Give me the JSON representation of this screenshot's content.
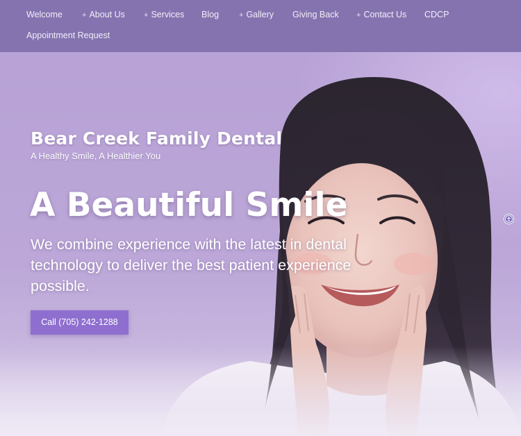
{
  "nav": {
    "items": [
      {
        "label": "Welcome",
        "has_submenu": false
      },
      {
        "label": "About Us",
        "has_submenu": true
      },
      {
        "label": "Services",
        "has_submenu": true
      },
      {
        "label": "Blog",
        "has_submenu": false
      },
      {
        "label": "Gallery",
        "has_submenu": true
      },
      {
        "label": "Giving Back",
        "has_submenu": false
      },
      {
        "label": "Contact Us",
        "has_submenu": true
      },
      {
        "label": "CDCP",
        "has_submenu": false
      },
      {
        "label": "Appointment Request",
        "has_submenu": false
      }
    ],
    "submenu_marker": "+"
  },
  "hero": {
    "brand_title": "Bear Creek Family Dental",
    "tagline": "A Healthy Smile, A Healthier You",
    "headline": "A Beautiful Smile",
    "body": "We combine experience with the latest in dental technology to deliver the best patient experience possible.",
    "cta_label": "Call (705) 242-1288"
  },
  "icons": {
    "accessibility": "accessibility-icon"
  },
  "colors": {
    "nav_background": "#8573b0",
    "hero_background": "#b9a3d4",
    "cta_background": "#8e6fcf",
    "text": "#ffffff"
  }
}
